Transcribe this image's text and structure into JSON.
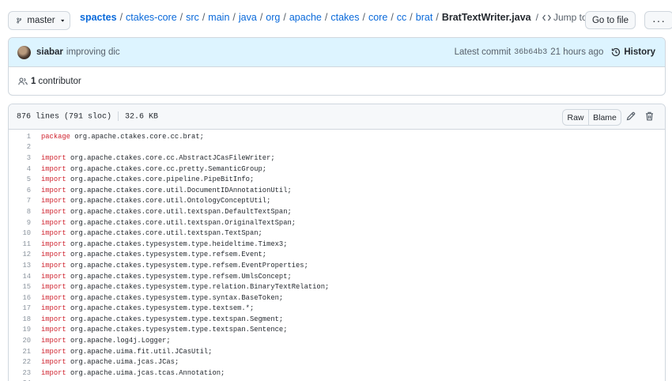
{
  "branch": {
    "label": "master"
  },
  "breadcrumb": {
    "repo": "spactes",
    "path": [
      "ctakes-core",
      "src",
      "main",
      "java",
      "org",
      "apache",
      "ctakes",
      "core",
      "cc",
      "brat"
    ],
    "file": "BratTextWriter.java",
    "jump_label": "Jump to"
  },
  "toolbar": {
    "goto_label": "Go to file",
    "more_label": "···"
  },
  "commit": {
    "author": "siabar",
    "message": "improving dic",
    "latest_label": "Latest commit",
    "sha": "36b64b3",
    "time": "21 hours ago",
    "history_label": "History"
  },
  "contributors": {
    "count": "1",
    "label": "contributor"
  },
  "file_header": {
    "lines": "876 lines (791 sloc)",
    "size": "32.6 KB",
    "raw_label": "Raw",
    "blame_label": "Blame"
  },
  "code_lines": [
    {
      "n": "1",
      "kw": "package",
      "rest": " org.apache.ctakes.core.cc.brat;"
    },
    {
      "n": "2",
      "kw": "",
      "rest": ""
    },
    {
      "n": "3",
      "kw": "import",
      "rest": " org.apache.ctakes.core.cc.AbstractJCasFileWriter;"
    },
    {
      "n": "4",
      "kw": "import",
      "rest": " org.apache.ctakes.core.cc.pretty.SemanticGroup;"
    },
    {
      "n": "5",
      "kw": "import",
      "rest": " org.apache.ctakes.core.pipeline.PipeBitInfo;"
    },
    {
      "n": "6",
      "kw": "import",
      "rest": " org.apache.ctakes.core.util.DocumentIDAnnotationUtil;"
    },
    {
      "n": "7",
      "kw": "import",
      "rest": " org.apache.ctakes.core.util.OntologyConceptUtil;"
    },
    {
      "n": "8",
      "kw": "import",
      "rest": " org.apache.ctakes.core.util.textspan.DefaultTextSpan;"
    },
    {
      "n": "9",
      "kw": "import",
      "rest": " org.apache.ctakes.core.util.textspan.OriginalTextSpan;"
    },
    {
      "n": "10",
      "kw": "import",
      "rest": " org.apache.ctakes.core.util.textspan.TextSpan;"
    },
    {
      "n": "11",
      "kw": "import",
      "rest": " org.apache.ctakes.typesystem.type.heideltime.Timex3;"
    },
    {
      "n": "12",
      "kw": "import",
      "rest": " org.apache.ctakes.typesystem.type.refsem.Event;"
    },
    {
      "n": "13",
      "kw": "import",
      "rest": " org.apache.ctakes.typesystem.type.refsem.EventProperties;"
    },
    {
      "n": "14",
      "kw": "import",
      "rest": " org.apache.ctakes.typesystem.type.refsem.UmlsConcept;"
    },
    {
      "n": "15",
      "kw": "import",
      "rest": " org.apache.ctakes.typesystem.type.relation.BinaryTextRelation;"
    },
    {
      "n": "16",
      "kw": "import",
      "rest": " org.apache.ctakes.typesystem.type.syntax.BaseToken;"
    },
    {
      "n": "17",
      "kw": "import",
      "rest": " org.apache.ctakes.typesystem.type.textsem.*;"
    },
    {
      "n": "18",
      "kw": "import",
      "rest": " org.apache.ctakes.typesystem.type.textspan.Segment;"
    },
    {
      "n": "19",
      "kw": "import",
      "rest": " org.apache.ctakes.typesystem.type.textspan.Sentence;"
    },
    {
      "n": "20",
      "kw": "import",
      "rest": " org.apache.log4j.Logger;"
    },
    {
      "n": "21",
      "kw": "import",
      "rest": " org.apache.uima.fit.util.JCasUtil;"
    },
    {
      "n": "22",
      "kw": "import",
      "rest": " org.apache.uima.jcas.JCas;"
    },
    {
      "n": "23",
      "kw": "import",
      "rest": " org.apache.uima.jcas.tcas.Annotation;"
    },
    {
      "n": "24",
      "kw": "",
      "rest": ""
    }
  ]
}
